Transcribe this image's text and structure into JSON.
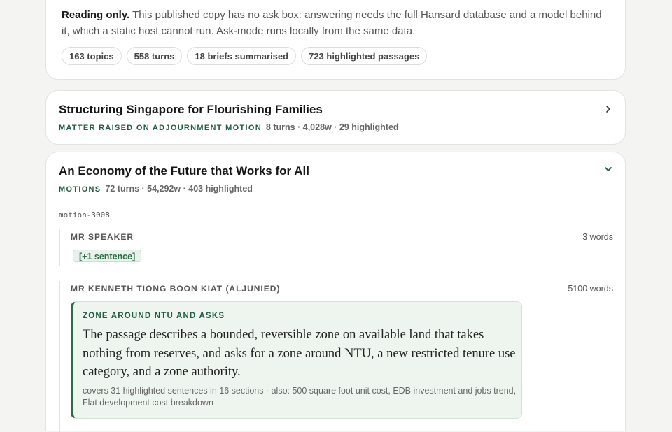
{
  "notice": {
    "lead": "Reading only.",
    "body": " This published copy has no ask box: answering needs the full Hansard database and a model behind it, which a static host cannot run. Ask-mode runs locally from the same data."
  },
  "stats_chips": [
    "163 topics",
    "558 turns",
    "18 briefs summarised",
    "723 highlighted passages"
  ],
  "topics": [
    {
      "title": "Structuring Singapore for Flourishing Families",
      "kind": "MATTER RAISED ON ADJOURNMENT MOTION",
      "stats": "8 turns · 4,028w · 29 highlighted",
      "chevron": "chevron-right-icon"
    },
    {
      "title": "An Economy of the Future that Works for All",
      "kind": "MOTIONS",
      "stats": "72 turns · 54,292w · 403 highlighted",
      "chevron": "chevron-down-icon",
      "motion_id": "motion-3008",
      "turns": [
        {
          "speaker": "MR SPEAKER",
          "words": "3 words",
          "sentence_chip": "[+1 sentence]"
        },
        {
          "speaker": "MR KENNETH TIONG BOON KIAT (ALJUNIED)",
          "words": "5100 words",
          "highlight": {
            "title": "ZONE AROUND NTU AND ASKS",
            "body": "The passage describes a bounded, reversible zone on available land that takes nothing from reserves, and asks for a zone around NTU, a new restricted tenure use category, and a zone authority.",
            "foot": "covers 31 highlighted sentences in 16 sections · also: 500 square foot unit cost, EDB investment and jobs trend, Flat development cost breakdown"
          }
        }
      ]
    }
  ],
  "colors": {
    "accent": "#1f5d3f",
    "highlight_bg": "#eef5ef",
    "page_bg": "#f4f4f2"
  }
}
